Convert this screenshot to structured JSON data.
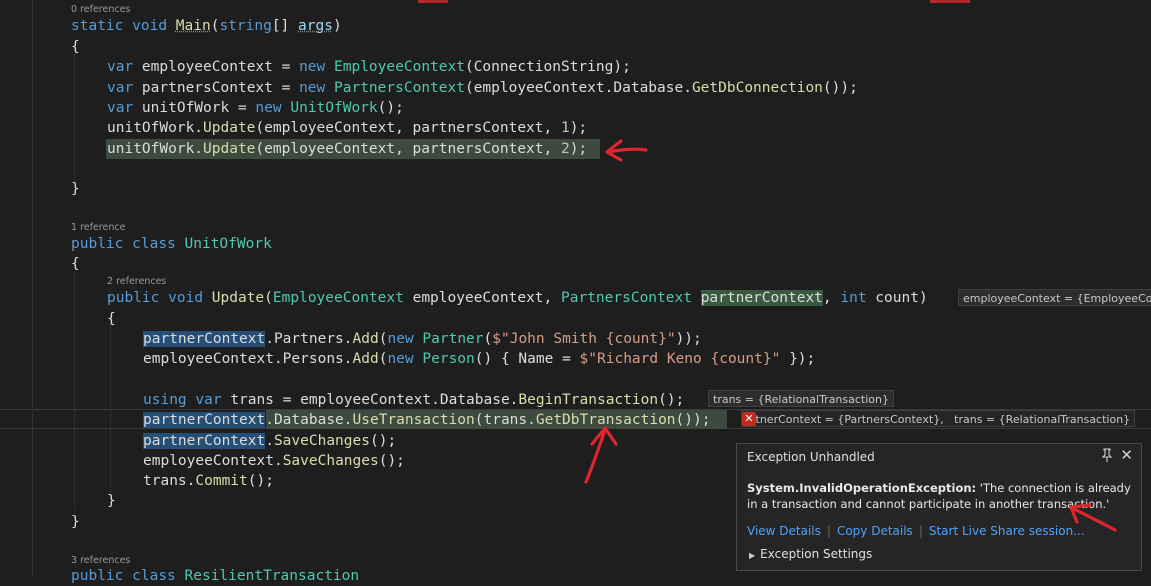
{
  "refs": {
    "main": "0 references",
    "unitofwork": "1 reference",
    "update": "2 references",
    "resilient": "3 references"
  },
  "code": {
    "l1": {
      "a": "static",
      "b": " ",
      "c": "void",
      "d": " ",
      "e": "Main",
      "f": "(",
      "g": "string",
      "h": "[] ",
      "i": "args",
      "j": ")"
    },
    "l2": "{",
    "l3": {
      "a": "var",
      "b": " employeeContext = ",
      "c": "new",
      "d": " ",
      "e": "EmployeeContext",
      "f": "(ConnectionString);"
    },
    "l4": {
      "a": "var",
      "b": " partnersContext = ",
      "c": "new",
      "d": " ",
      "e": "PartnersContext",
      "f": "(employeeContext.Database.",
      "g": "GetDbConnection",
      "h": "());"
    },
    "l5": {
      "a": "var",
      "b": " unitOfWork = ",
      "c": "new",
      "d": " ",
      "e": "UnitOfWork",
      "f": "();"
    },
    "l6": {
      "a": "unitOfWork.",
      "b": "Update",
      "c": "(employeeContext, partnersContext, ",
      "d": "1",
      "e": ");"
    },
    "l7": {
      "a": "unitOfWork.",
      "b": "Update",
      "c": "(employeeContext, partnersContext, ",
      "d": "2",
      "e": ");"
    },
    "l8": "}",
    "l9": {
      "a": "public",
      "b": " ",
      "c": "class",
      "d": " ",
      "e": "UnitOfWork"
    },
    "l10": "{",
    "l11": {
      "a": "public",
      "b": " ",
      "c": "void",
      "d": " ",
      "e": "Update",
      "f": "(",
      "g": "EmployeeContext",
      "h": " employeeContext, ",
      "i": "PartnersContext",
      "j": " ",
      "k": "partnerContext",
      "l": ", ",
      "m": "int",
      "n": " count)"
    },
    "l12": "{",
    "l13": {
      "a": "partnerContext",
      "b": ".Partners.",
      "c": "Add",
      "d": "(",
      "e": "new",
      "f": " ",
      "g": "Partner",
      "h": "(",
      "i": "$\"John Smith {count}\"",
      "j": "));"
    },
    "l14": {
      "a": "employeeContext.Persons.",
      "b": "Add",
      "c": "(",
      "d": "new",
      "e": " ",
      "f": "Person",
      "g": "() { Name = ",
      "h": "$\"Richard Keno {count}\"",
      "i": " });"
    },
    "l15": {
      "a": "using",
      "b": " ",
      "c": "var",
      "d": " trans = employeeContext.Database.",
      "e": "BeginTransaction",
      "f": "();"
    },
    "l16": {
      "a": "partnerContext",
      "b": ".Database.",
      "c": "UseTransaction",
      "d": "(trans.",
      "e": "GetDbTransaction",
      "f": "());"
    },
    "l17": {
      "a": "partnerContext",
      "b": ".",
      "c": "SaveChanges",
      "d": "();"
    },
    "l18": {
      "a": "employeeContext.",
      "b": "SaveChanges",
      "c": "();"
    },
    "l19": {
      "a": "trans.",
      "b": "Commit",
      "c": "();"
    },
    "l20": "}",
    "l21": "}",
    "l22": {
      "a": "public",
      "b": " ",
      "c": "class",
      "d": " ",
      "e": "ResilientTransaction"
    }
  },
  "hints": {
    "update_params": "employeeContext = {EmployeeCon",
    "trans_begin": "trans = {RelationalTransaction}",
    "use_trans": "rtnerContext = {PartnersContext},   trans = {RelationalTransaction}"
  },
  "exception": {
    "title": "Exception Unhandled",
    "type": "System.InvalidOperationException:",
    "message": " 'The connection is already in a transaction and cannot participate in another transaction.'",
    "link_view": "View Details",
    "link_copy": "Copy Details",
    "link_share": "Start Live Share session...",
    "settings": "Exception Settings"
  },
  "icons": {
    "pin": "pin-icon",
    "close": "close-icon",
    "error": "error-icon",
    "expand": "triangle-right-icon"
  },
  "colors": {
    "keyword": "#569cd6",
    "type": "#4ec9b0",
    "method": "#dcdcaa",
    "string": "#d69d85",
    "number": "#b5cea8",
    "annotation_red": "#e0262d",
    "link": "#4fa3f7"
  }
}
